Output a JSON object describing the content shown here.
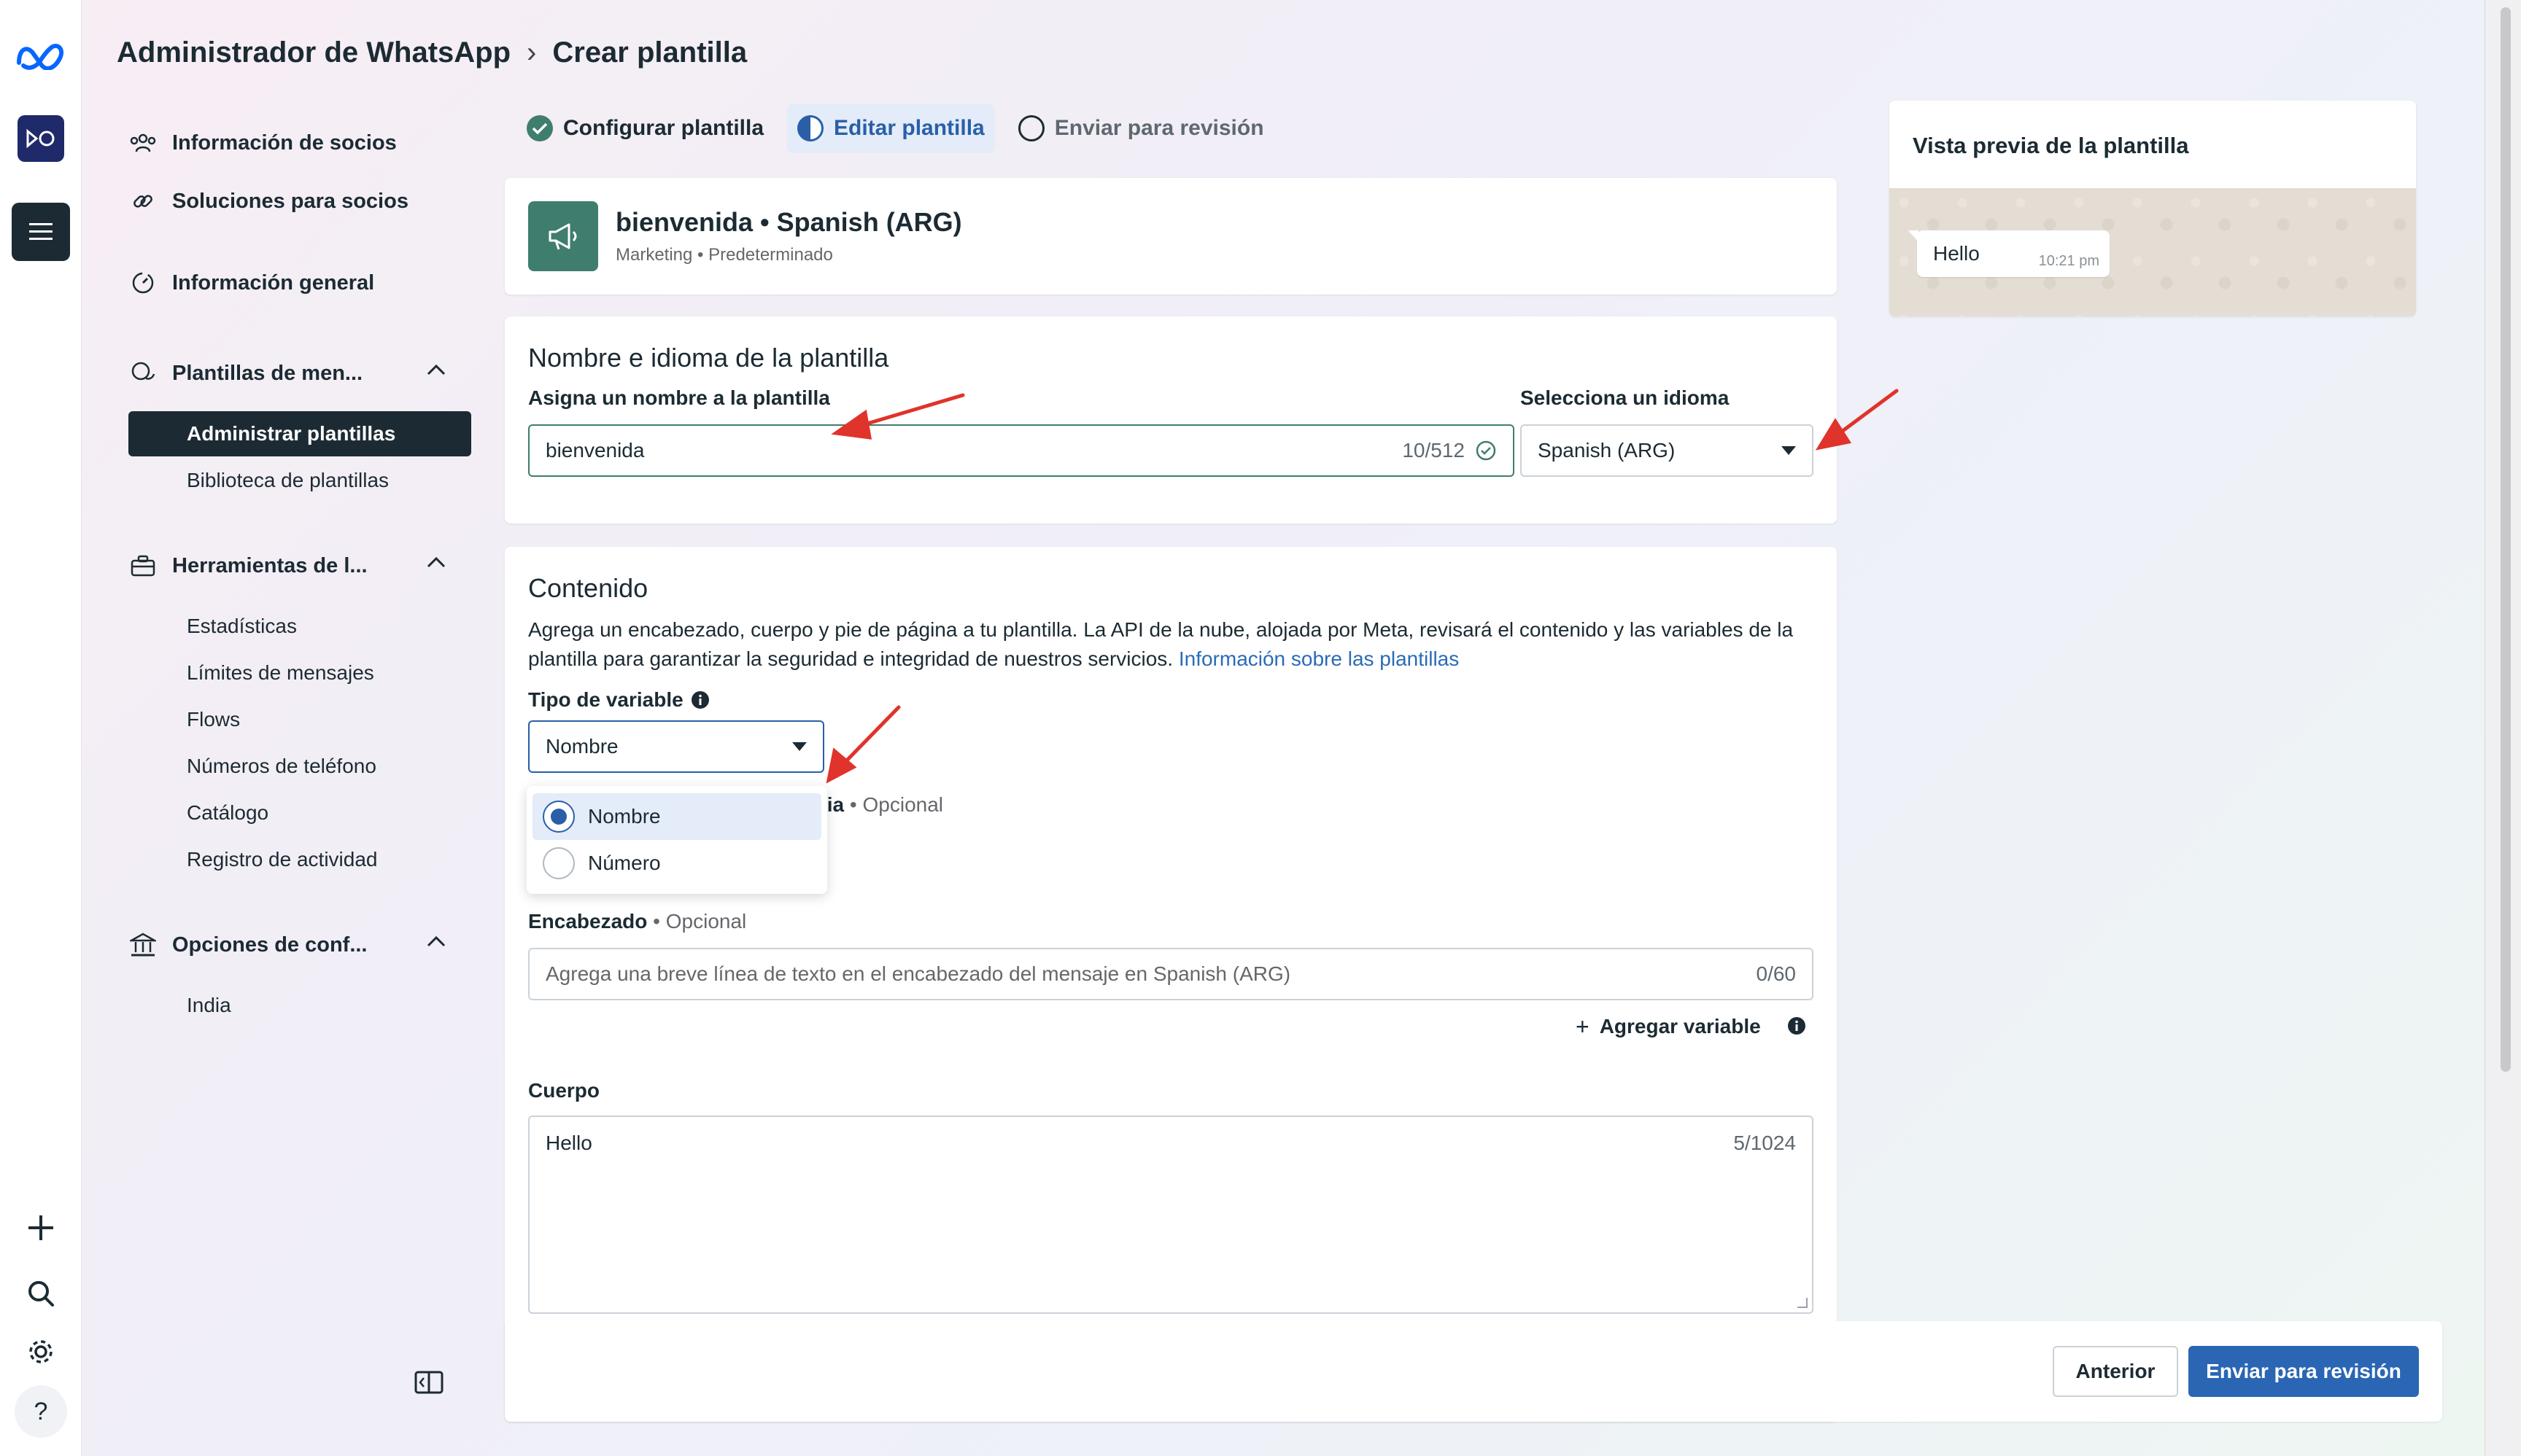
{
  "breadcrumb": {
    "root": "Administrador de WhatsApp",
    "current": "Crear plantilla"
  },
  "sidebar": {
    "items": [
      {
        "label": "Información de socios",
        "icon": "people-icon"
      },
      {
        "label": "Soluciones para socios",
        "icon": "link-icon"
      },
      {
        "label": "Información general",
        "icon": "dashboard-icon"
      },
      {
        "label": "Plantillas de men...",
        "icon": "chat-bubbles-icon"
      },
      {
        "label": "Herramientas de l...",
        "icon": "briefcase-icon"
      },
      {
        "label": "Opciones de conf...",
        "icon": "bank-icon"
      }
    ],
    "templates_sub": [
      "Administrar plantillas",
      "Biblioteca de plantillas"
    ],
    "tools_sub": [
      "Estadísticas",
      "Límites de mensajes",
      "Flows",
      "Números de teléfono",
      "Catálogo",
      "Registro de actividad"
    ],
    "config_sub": [
      "India"
    ]
  },
  "stepper": {
    "step1": "Configurar plantilla",
    "step2": "Editar plantilla",
    "step3": "Enviar para revisión"
  },
  "template": {
    "title": "bienvenida • Spanish (ARG)",
    "category": "Marketing",
    "meta_sep": " • Predeterminado"
  },
  "name_section": {
    "title": "Nombre e idioma de la plantilla",
    "name_label": "Asigna un nombre a la plantilla",
    "name_value": "bienvenida",
    "name_count": "10/512",
    "lang_label": "Selecciona un idioma",
    "lang_value": "Spanish (ARG)"
  },
  "content": {
    "title": "Contenido",
    "desc": "Agrega un encabezado, cuerpo y pie de página a tu plantilla. La API de la nube, alojada por Meta, revisará el contenido y las variables de la plantilla para garantizar la seguridad e integridad de nuestros servicios. ",
    "link": "Información sobre las plantillas",
    "var_type_label": "Tipo de variable",
    "var_type_value": "Nombre",
    "options": [
      "Nombre",
      "Número"
    ],
    "media_label_tail": "lia",
    "optional": " • Opcional",
    "header_label": "Encabezado",
    "header_placeholder": "Agrega una breve línea de texto en el encabezado del mensaje en Spanish (ARG)",
    "header_count": "0/60",
    "add_variable": "Agregar variable",
    "body_label": "Cuerpo",
    "body_value": "Hello",
    "body_count": "5/1024"
  },
  "footer": {
    "back": "Anterior",
    "submit": "Enviar para revisión"
  },
  "preview": {
    "title": "Vista previa de la plantilla",
    "message": "Hello",
    "time": "10:21 pm"
  },
  "rail": {
    "help": "?"
  },
  "colors": {
    "accent": "#2a66b4",
    "brand_green": "#3f7d6f",
    "annotation_red": "#e0332b"
  }
}
